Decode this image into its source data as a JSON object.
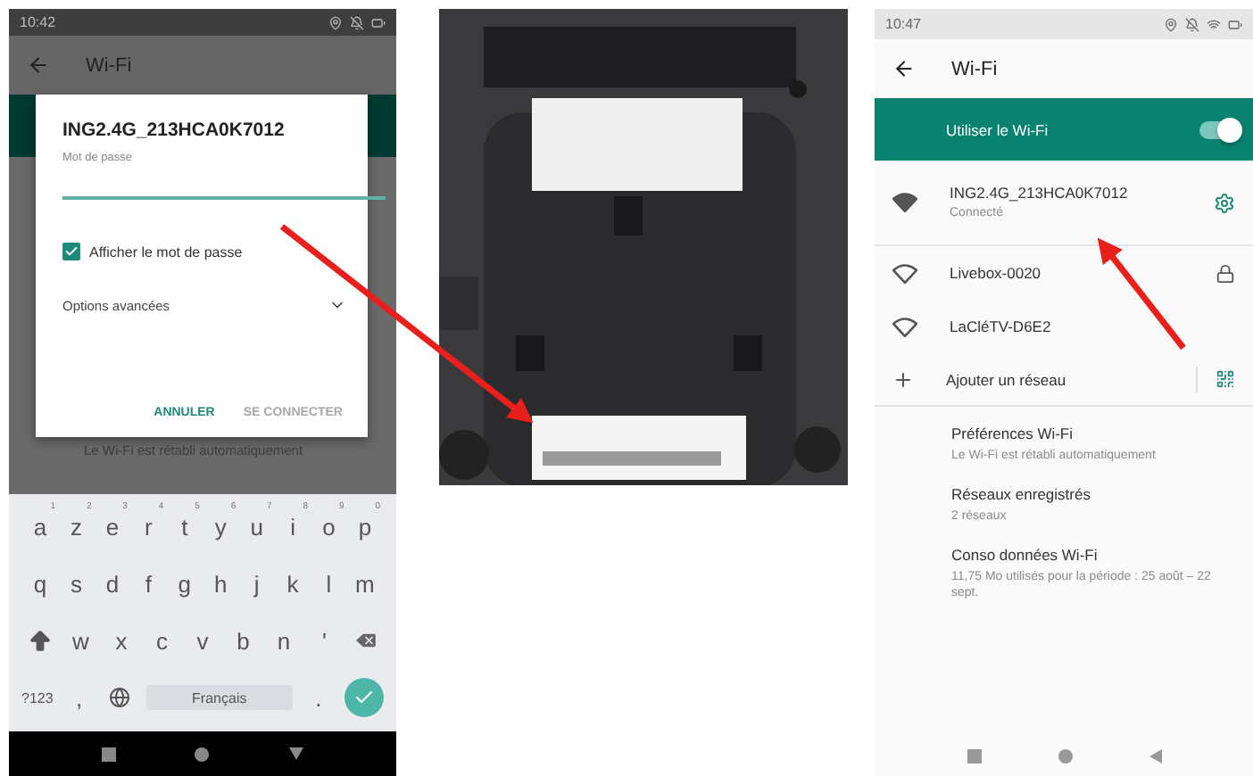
{
  "left_phone": {
    "status_bar": {
      "time": "10:42"
    },
    "app_bar": {
      "title": "Wi-Fi"
    },
    "background_text": "Le Wi-Fi est rétabli automatiquement",
    "dialog": {
      "title": "ING2.4G_213HCA0K7012",
      "password_label": "Mot de passe",
      "show_password": {
        "label": "Afficher le mot de passe",
        "checked": true
      },
      "advanced_options": {
        "label": "Options avancées",
        "expanded": false
      },
      "buttons": [
        {
          "label": "ANNULER",
          "disabled": false
        },
        {
          "label": "SE CONNECTER",
          "disabled": true
        }
      ]
    },
    "keyboard": {
      "rows": [
        {
          "keys": [
            {
              "kind": "letter",
              "label": "a",
              "hint": "1"
            },
            {
              "kind": "letter",
              "label": "z",
              "hint": "2"
            },
            {
              "kind": "letter",
              "label": "e",
              "hint": "3"
            },
            {
              "kind": "letter",
              "label": "r",
              "hint": "4"
            },
            {
              "kind": "letter",
              "label": "t",
              "hint": "5"
            },
            {
              "kind": "letter",
              "label": "y",
              "hint": "6"
            },
            {
              "kind": "letter",
              "label": "u",
              "hint": "7"
            },
            {
              "kind": "letter",
              "label": "i",
              "hint": "8"
            },
            {
              "kind": "letter",
              "label": "o",
              "hint": "9"
            },
            {
              "kind": "letter",
              "label": "p",
              "hint": "0"
            }
          ]
        },
        {
          "keys": [
            {
              "kind": "letter",
              "label": "q"
            },
            {
              "kind": "letter",
              "label": "s"
            },
            {
              "kind": "letter",
              "label": "d"
            },
            {
              "kind": "letter",
              "label": "f"
            },
            {
              "kind": "letter",
              "label": "g"
            },
            {
              "kind": "letter",
              "label": "h"
            },
            {
              "kind": "letter",
              "label": "j"
            },
            {
              "kind": "letter",
              "label": "k"
            },
            {
              "kind": "letter",
              "label": "l"
            },
            {
              "kind": "letter",
              "label": "m"
            }
          ]
        },
        {
          "keys": [
            {
              "kind": "shift"
            },
            {
              "kind": "letter",
              "label": "w"
            },
            {
              "kind": "letter",
              "label": "x"
            },
            {
              "kind": "letter",
              "label": "c"
            },
            {
              "kind": "letter",
              "label": "v"
            },
            {
              "kind": "letter",
              "label": "b"
            },
            {
              "kind": "letter",
              "label": "n"
            },
            {
              "kind": "letter",
              "label": "'"
            },
            {
              "kind": "backspace"
            }
          ]
        },
        {
          "keys": [
            {
              "kind": "symbols",
              "label": "?123"
            },
            {
              "kind": "letter",
              "label": ","
            },
            {
              "kind": "globe"
            },
            {
              "kind": "space",
              "label": "Français"
            },
            {
              "kind": "letter",
              "label": "."
            },
            {
              "kind": "enter"
            }
          ]
        }
      ]
    }
  },
  "right_phone": {
    "status_bar": {
      "time": "10:47"
    },
    "app_bar": {
      "title": "Wi-Fi"
    },
    "wifi_toggle": {
      "label": "Utiliser le Wi-Fi",
      "on": true
    },
    "networks": [
      {
        "name": "ING2.4G_213HCA0K7012",
        "status": "Connecté",
        "kind": "connected"
      },
      {
        "name": "Livebox-0020",
        "kind": "locked"
      },
      {
        "name": "LaCléTV-D6E2",
        "kind": "open"
      }
    ],
    "add_network": {
      "label": "Ajouter un réseau"
    },
    "settings": [
      {
        "title": "Préférences Wi-Fi",
        "subtitle": "Le Wi-Fi est rétabli automatiquement"
      },
      {
        "title": "Réseaux enregistrés",
        "subtitle": "2 réseaux"
      },
      {
        "title": "Conso données Wi-Fi",
        "subtitle": "11,75 Mo utilisés pour la période : 25 août – 22 sept."
      }
    ]
  }
}
